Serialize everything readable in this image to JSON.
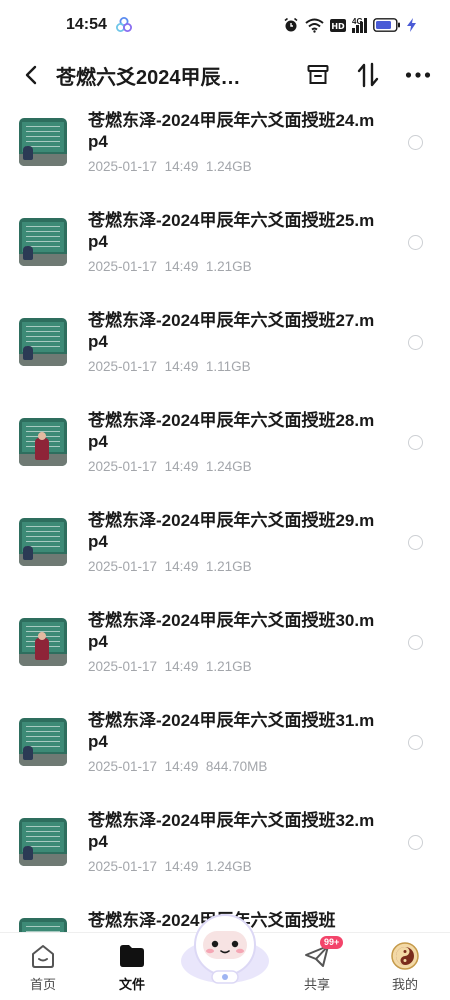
{
  "status_bar": {
    "time": "14:54",
    "network": "4G",
    "icons": [
      "app-clover-icon",
      "alarm-icon",
      "wifi-icon",
      "hd-icon",
      "signal-icon",
      "battery-icon",
      "charging-icon"
    ]
  },
  "header": {
    "title": "苍燃六爻2024甲辰…",
    "icons": [
      "back-icon",
      "archive-icon",
      "sort-icon",
      "more-icon"
    ]
  },
  "files": [
    {
      "name": "苍燃东泽-2024甲辰年六爻面授班24.mp4",
      "date": "2025-01-17",
      "time": "14:49",
      "size": "1.24GB",
      "thumb": "green"
    },
    {
      "name": "苍燃东泽-2024甲辰年六爻面授班25.mp4",
      "date": "2025-01-17",
      "time": "14:49",
      "size": "1.21GB",
      "thumb": "green"
    },
    {
      "name": "苍燃东泽-2024甲辰年六爻面授班27.mp4",
      "date": "2025-01-17",
      "time": "14:49",
      "size": "1.11GB",
      "thumb": "green"
    },
    {
      "name": "苍燃东泽-2024甲辰年六爻面授班28.mp4",
      "date": "2025-01-17",
      "time": "14:49",
      "size": "1.24GB",
      "thumb": "red"
    },
    {
      "name": "苍燃东泽-2024甲辰年六爻面授班29.mp4",
      "date": "2025-01-17",
      "time": "14:49",
      "size": "1.21GB",
      "thumb": "green"
    },
    {
      "name": "苍燃东泽-2024甲辰年六爻面授班30.mp4",
      "date": "2025-01-17",
      "time": "14:49",
      "size": "1.21GB",
      "thumb": "red"
    },
    {
      "name": "苍燃东泽-2024甲辰年六爻面授班31.mp4",
      "date": "2025-01-17",
      "time": "14:49",
      "size": "844.70MB",
      "thumb": "green"
    },
    {
      "name": "苍燃东泽-2024甲辰年六爻面授班32.mp4",
      "date": "2025-01-17",
      "time": "14:49",
      "size": "1.24GB",
      "thumb": "green"
    },
    {
      "name": "苍燃东泽-2024甲辰年六爻面授班",
      "date": "",
      "time": "",
      "size": "",
      "thumb": "green"
    }
  ],
  "tabbar": {
    "tabs": [
      {
        "label": "首页",
        "icon": "home-icon",
        "active": false
      },
      {
        "label": "文件",
        "icon": "folder-icon",
        "active": true
      },
      {
        "label": "共享",
        "icon": "share-icon",
        "active": false,
        "badge": "99+"
      },
      {
        "label": "我的",
        "icon": "avatar-icon",
        "active": false
      }
    ],
    "center": "astronaut-mascot-icon"
  },
  "colors": {
    "text_primary": "#1a1a1a",
    "text_meta": "#a3a6ab",
    "badge": "#f3446a",
    "battery": "#4a5bd6"
  }
}
